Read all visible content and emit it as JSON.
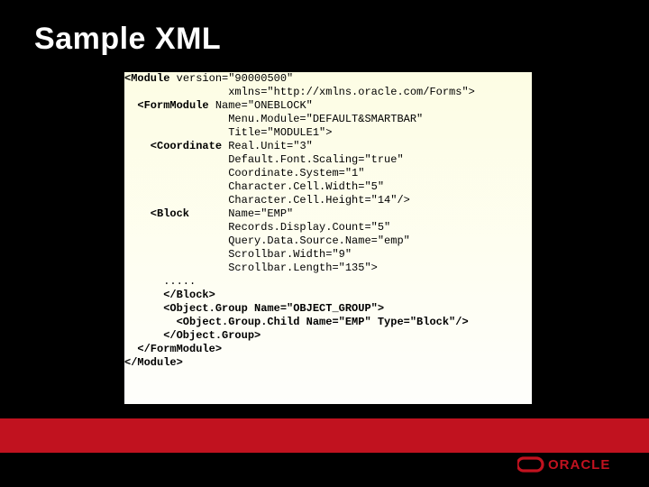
{
  "title": "Sample XML",
  "code": {
    "l01a": "<Module",
    "l01b": " version=\"90000500\"",
    "l02": "                xmlns=\"http://xmlns.oracle.com/Forms\">",
    "l03a": "  <FormModule",
    "l03b": " Name=\"ONEBLOCK\"",
    "l04": "                Menu.Module=\"DEFAULT&SMARTBAR\"",
    "l05": "                Title=\"MODULE1\">",
    "l06a": "    <Coordinate",
    "l06b": " Real.Unit=\"3\"",
    "l07": "                Default.Font.Scaling=\"true\"",
    "l08": "                Coordinate.System=\"1\"",
    "l09": "                Character.Cell.Width=\"5\"",
    "l10": "                Character.Cell.Height=\"14\"/>",
    "l11a": "    <Block",
    "l11b": "      Name=\"EMP\"",
    "l12": "                Records.Display.Count=\"5\"",
    "l13": "                Query.Data.Source.Name=\"emp\"",
    "l14": "                Scrollbar.Width=\"9\"",
    "l15": "                Scrollbar.Length=\"135\">",
    "l16": "      .....",
    "l17": "      </Block>",
    "l18": "      <Object.Group Name=\"OBJECT_GROUP\">",
    "l19": "        <Object.Group.Child Name=\"EMP\" Type=\"Block\"/>",
    "l20": "      </Object.Group>",
    "l21": "  </FormModule>",
    "l22": "</Module>"
  },
  "brand": "ORACLE"
}
